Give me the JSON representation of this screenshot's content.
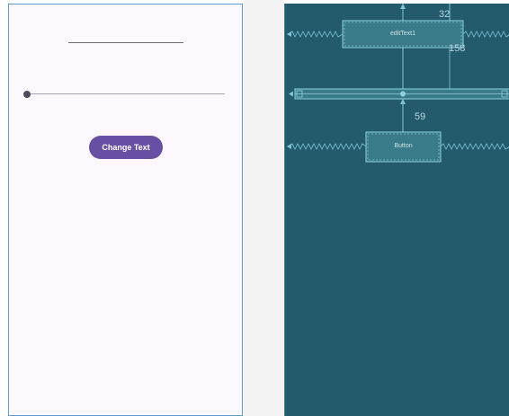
{
  "design": {
    "button_label": "Change Text"
  },
  "blueprint": {
    "edittext_label": "editText1",
    "button_label": "Button",
    "margin_top_edit": "32",
    "margin_top_slider": "158",
    "margin_top_button": "59"
  },
  "colors": {
    "accent": "#6750a4",
    "blueprint_bg": "#235b6d",
    "blueprint_line": "#7fc6d6"
  }
}
